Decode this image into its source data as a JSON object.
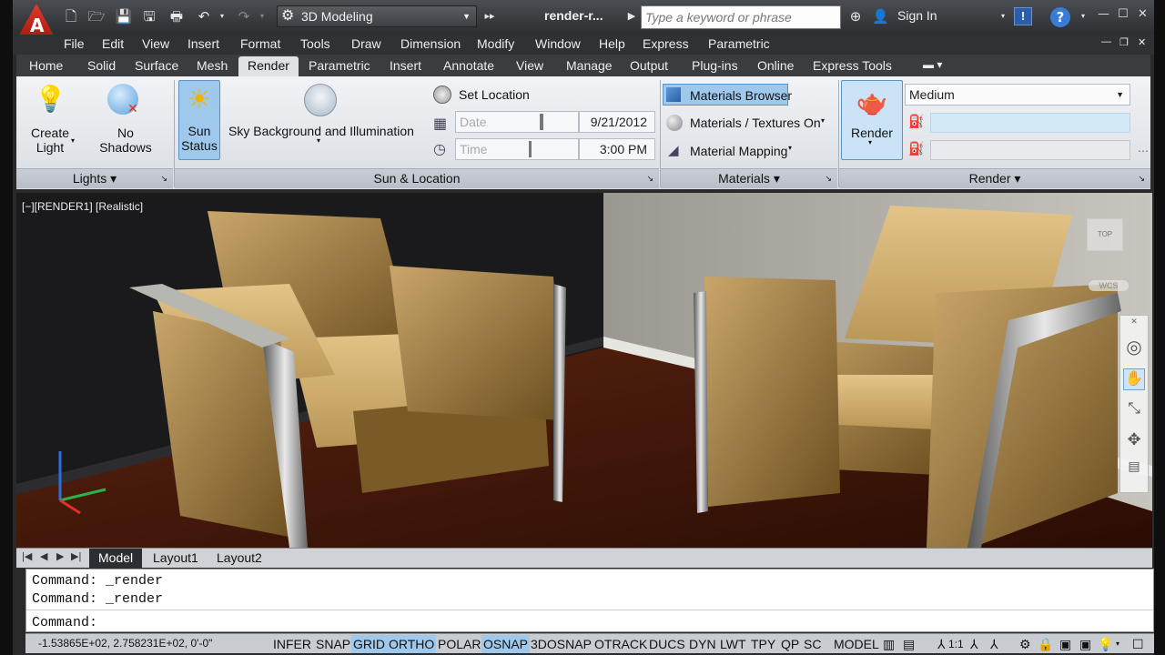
{
  "titlebar": {
    "workspace": "3D Modeling",
    "document": "render-r...",
    "search_placeholder": "Type a keyword or phrase",
    "sign_in": "Sign In",
    "logo": "A"
  },
  "menu": [
    "File",
    "Edit",
    "View",
    "Insert",
    "Format",
    "Tools",
    "Draw",
    "Dimension",
    "Modify",
    "Window",
    "Help",
    "Express",
    "Parametric"
  ],
  "tabs": [
    "Home",
    "Solid",
    "Surface",
    "Mesh",
    "Render",
    "Parametric",
    "Insert",
    "Annotate",
    "View",
    "Manage",
    "Output",
    "Plug-ins",
    "Online",
    "Express Tools"
  ],
  "active_tab": "Render",
  "lights": {
    "create_light": "Create\nLight",
    "no_shadows": "No Shadows",
    "panel": "Lights"
  },
  "sun": {
    "sun_status": "Sun\nStatus",
    "sky": "Sky Background and Illumination",
    "set_location": "Set Location",
    "date_label": "Date",
    "date_value": "9/21/2012",
    "time_label": "Time",
    "time_value": "3:00 PM",
    "panel": "Sun & Location"
  },
  "materials": {
    "browser": "Materials Browser",
    "textures": "Materials / Textures On",
    "mapping": "Material Mapping",
    "panel": "Materials"
  },
  "render": {
    "button": "Render",
    "quality": "Medium",
    "panel": "Render"
  },
  "viewport": {
    "label": "[−][RENDER1] [Realistic]",
    "wcs": "WCS",
    "viewcube": "TOP"
  },
  "layouts": [
    "Model",
    "Layout1",
    "Layout2"
  ],
  "command": {
    "lines": [
      "Command:  _render",
      "Command:  _render"
    ],
    "prompt": "Command:"
  },
  "status": {
    "coords": "-1.53865E+02, 2.758231E+02, 0'-0\"",
    "toggles": [
      {
        "label": "INFER",
        "on": false
      },
      {
        "label": "SNAP",
        "on": false
      },
      {
        "label": "GRID",
        "on": true
      },
      {
        "label": "ORTHO",
        "on": true
      },
      {
        "label": "POLAR",
        "on": false
      },
      {
        "label": "OSNAP",
        "on": true
      },
      {
        "label": "3DOSNAP",
        "on": false
      },
      {
        "label": "OTRACK",
        "on": false
      },
      {
        "label": "DUCS",
        "on": false
      },
      {
        "label": "DYN",
        "on": false
      },
      {
        "label": "LWT",
        "on": false
      },
      {
        "label": "TPY",
        "on": false
      },
      {
        "label": "QP",
        "on": false
      },
      {
        "label": "SC",
        "on": false
      }
    ],
    "model": "MODEL",
    "scale": "1:1"
  },
  "colors": {
    "ribbon_active": "#9fc9ec",
    "brand_red": "#d42b1e"
  }
}
